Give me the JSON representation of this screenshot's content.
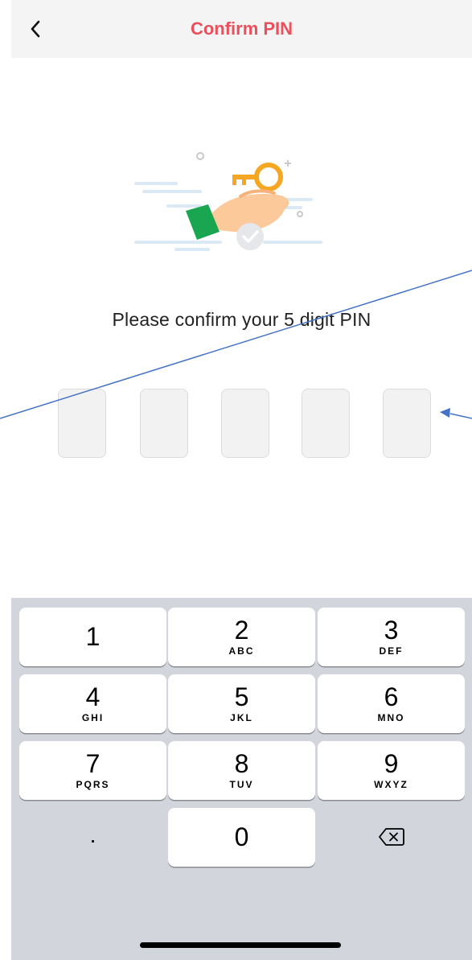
{
  "header": {
    "title": "Confirm PIN",
    "back_icon": "chevron-left-icon",
    "title_color": "#e8505b",
    "background": "#f5f4f5"
  },
  "illustration": {
    "icon": "hand-holding-key-icon"
  },
  "prompt": {
    "text": "Please confirm your 5 digit PIN"
  },
  "pin": {
    "length": 5,
    "entered": ""
  },
  "keyboard": {
    "background": "#d2d5db",
    "keys": [
      {
        "digit": "1",
        "letters": ""
      },
      {
        "digit": "2",
        "letters": "ABC"
      },
      {
        "digit": "3",
        "letters": "DEF"
      },
      {
        "digit": "4",
        "letters": "GHI"
      },
      {
        "digit": "5",
        "letters": "JKL"
      },
      {
        "digit": "6",
        "letters": "MNO"
      },
      {
        "digit": "7",
        "letters": "PQRS"
      },
      {
        "digit": "8",
        "letters": "TUV"
      },
      {
        "digit": "9",
        "letters": "WXYZ"
      },
      {
        "digit": ".",
        "letters": ""
      },
      {
        "digit": "0",
        "letters": ""
      },
      {
        "digit": "",
        "letters": "",
        "icon": "backspace-icon"
      }
    ]
  },
  "annotation": {
    "color": "#4472c4",
    "icon": "arrow-annotation"
  }
}
